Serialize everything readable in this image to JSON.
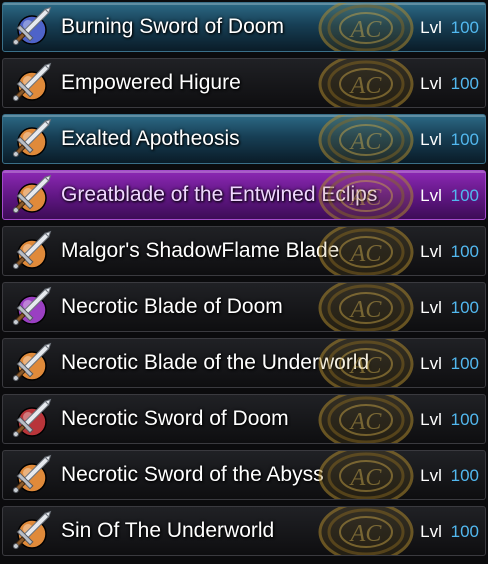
{
  "level_label": "Lvl",
  "colors": {
    "level_value": "#52b8ef",
    "selected_row": "#6a1a93",
    "highlight_row": "#1f5872",
    "orb_orange": "#e08a3a",
    "orb_blue": "#4e63c9",
    "orb_purple": "#9a3fc2",
    "orb_red": "#b8353a"
  },
  "items": [
    {
      "name": "Burning Sword of Doom",
      "level": "100",
      "style": "teal",
      "orb": "blue",
      "icon": "sword-icon"
    },
    {
      "name": "Empowered Higure",
      "level": "100",
      "style": "dark",
      "orb": "orange",
      "icon": "sword-icon"
    },
    {
      "name": "Exalted Apotheosis",
      "level": "100",
      "style": "teal",
      "orb": "orange",
      "icon": "sword-icon"
    },
    {
      "name": "Greatblade of the Entwined Eclips",
      "level": "100",
      "style": "purple",
      "orb": "orange",
      "icon": "sword-icon"
    },
    {
      "name": "Malgor's ShadowFlame Blade",
      "level": "100",
      "style": "dark",
      "orb": "orange",
      "icon": "sword-icon"
    },
    {
      "name": "Necrotic Blade of Doom",
      "level": "100",
      "style": "dark",
      "orb": "purple",
      "icon": "sword-icon"
    },
    {
      "name": "Necrotic Blade of the Underworld",
      "level": "100",
      "style": "dark",
      "orb": "orange",
      "icon": "sword-icon"
    },
    {
      "name": "Necrotic Sword of Doom",
      "level": "100",
      "style": "dark",
      "orb": "red",
      "icon": "sword-icon"
    },
    {
      "name": "Necrotic Sword of the Abyss",
      "level": "100",
      "style": "dark",
      "orb": "orange",
      "icon": "sword-icon"
    },
    {
      "name": "Sin Of The Underworld",
      "level": "100",
      "style": "dark",
      "orb": "orange",
      "icon": "sword-icon"
    }
  ],
  "emblem": {
    "text": "AC",
    "icon": "ac-emblem-icon"
  }
}
